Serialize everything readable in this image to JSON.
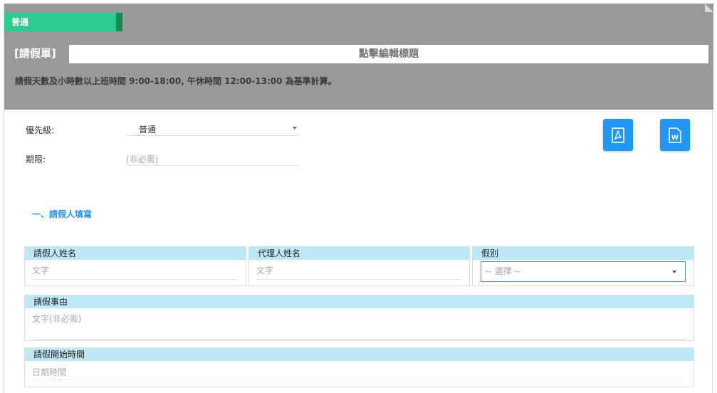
{
  "header": {
    "priority_tag": "普通",
    "form_name": "[請假單]",
    "title_placeholder": "點擊編輯標題",
    "note": "請假天數及小時數以上班時間 9:00-18:00, 午休時間  12:00-13:00 為基準計算。"
  },
  "meta_fields": {
    "priority_label": "優先級:",
    "priority_value": "普通",
    "deadline_label": "期限:",
    "deadline_placeholder": "(非必需)"
  },
  "export": {
    "pdf_icon": "pdf-icon",
    "word_icon": "word-icon",
    "word_letter": "W"
  },
  "section": {
    "title": "一、請假人填寫"
  },
  "fields": {
    "applicant_name_label": "請假人姓名",
    "applicant_name_placeholder": "文字",
    "agent_name_label": "代理人姓名",
    "agent_name_placeholder": "文字",
    "leave_type_label": "假別",
    "leave_type_placeholder": "-- 選擇 --",
    "reason_label": "請假事由",
    "reason_placeholder": "文字(非必需)",
    "start_time_label": "請假開始時間",
    "start_time_placeholder": "日期時間"
  },
  "colors": {
    "header_bg": "#999999",
    "priority_tag": "#2ecc91",
    "accent_blue": "#2196f3",
    "field_head_bg": "#bde9f7"
  }
}
